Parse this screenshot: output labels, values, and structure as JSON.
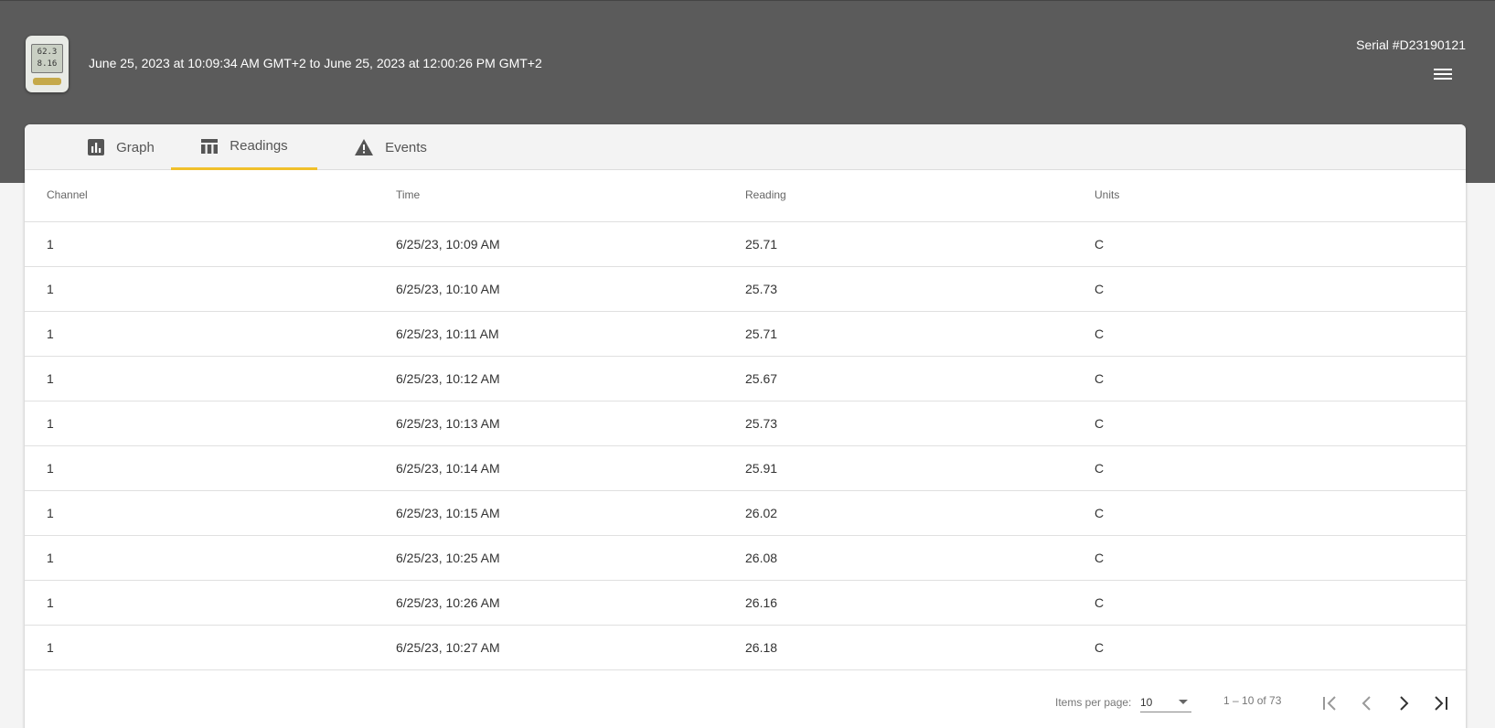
{
  "header": {
    "date_range": "June 25, 2023 at 10:09:34 AM GMT+2 to June 25, 2023 at 12:00:26 PM GMT+2",
    "serial": "Serial #D23190121",
    "device_display": [
      "62.3",
      "8.16"
    ]
  },
  "tabs": [
    {
      "label": "Graph",
      "icon": "bar-chart-icon",
      "active": false
    },
    {
      "label": "Readings",
      "icon": "table-icon",
      "active": true
    },
    {
      "label": "Events",
      "icon": "warning-icon",
      "active": false
    }
  ],
  "table": {
    "columns": [
      "Channel",
      "Time",
      "Reading",
      "Units"
    ],
    "rows": [
      [
        "1",
        "6/25/23, 10:09 AM",
        "25.71",
        "C"
      ],
      [
        "1",
        "6/25/23, 10:10 AM",
        "25.73",
        "C"
      ],
      [
        "1",
        "6/25/23, 10:11 AM",
        "25.71",
        "C"
      ],
      [
        "1",
        "6/25/23, 10:12 AM",
        "25.67",
        "C"
      ],
      [
        "1",
        "6/25/23, 10:13 AM",
        "25.73",
        "C"
      ],
      [
        "1",
        "6/25/23, 10:14 AM",
        "25.91",
        "C"
      ],
      [
        "1",
        "6/25/23, 10:15 AM",
        "26.02",
        "C"
      ],
      [
        "1",
        "6/25/23, 10:25 AM",
        "26.08",
        "C"
      ],
      [
        "1",
        "6/25/23, 10:26 AM",
        "26.16",
        "C"
      ],
      [
        "1",
        "6/25/23, 10:27 AM",
        "26.18",
        "C"
      ]
    ]
  },
  "paginator": {
    "items_per_page_label": "Items per page:",
    "items_per_page": "10",
    "range_label": "1 – 10 of 73"
  },
  "colors": {
    "header_bg": "#5b5b5b",
    "accent": "#f0c02a"
  }
}
